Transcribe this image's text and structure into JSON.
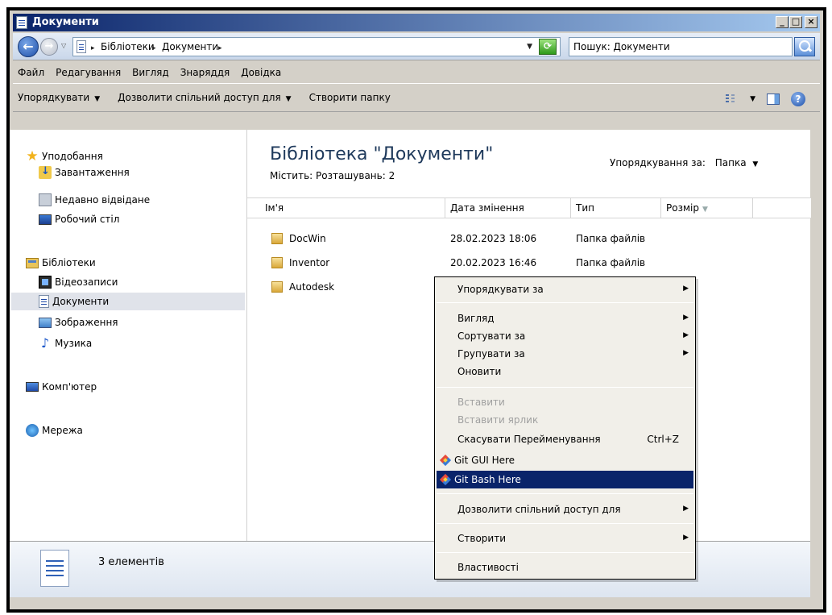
{
  "window": {
    "title": "Документи"
  },
  "address": {
    "crumbs": [
      "Бібліотеки",
      "Документи"
    ],
    "search_placeholder": "Пошук: Документи"
  },
  "menubar": [
    "Файл",
    "Редагування",
    "Вигляд",
    "Знаряддя",
    "Довідка"
  ],
  "commands": {
    "organize": "Упорядкувати",
    "share": "Дозволити спільний доступ для",
    "new_folder": "Створити папку"
  },
  "nav": {
    "favorites": "Уподобання",
    "downloads": "Завантаження",
    "recent": "Недавно відвідане",
    "desktop": "Робочий стіл",
    "libraries": "Бібліотеки",
    "videos": "Відеозаписи",
    "documents": "Документи",
    "pictures": "Зображення",
    "music": "Музика",
    "computer": "Комп'ютер",
    "network": "Мережа"
  },
  "main": {
    "title": "Бібліотека \"Документи\"",
    "subtitle": "Містить: Розташувань: 2",
    "arrange_label": "Упорядкування за:",
    "arrange_value": "Папка",
    "columns": [
      "Ім'я",
      "Дата змінення",
      "Тип",
      "Розмір"
    ],
    "files": [
      {
        "name": "DocWin",
        "date": "28.02.2023 18:06",
        "type": "Папка файлів"
      },
      {
        "name": "Inventor",
        "date": "20.02.2023 16:46",
        "type": "Папка файлів"
      },
      {
        "name": "Autodesk",
        "date": "",
        "type": ""
      }
    ]
  },
  "details": {
    "count": "3 елементів"
  },
  "context_menu": {
    "arrange_by": "Упорядкувати за",
    "view": "Вигляд",
    "sort_by": "Сортувати за",
    "group_by": "Групувати за",
    "refresh": "Оновити",
    "paste": "Вставити",
    "paste_shortcut": "Вставити ярлик",
    "undo_rename": "Скасувати Перейменування",
    "undo_shortcut": "Ctrl+Z",
    "git_gui": "Git GUI Here",
    "git_bash": "Git Bash Here",
    "share_with": "Дозволити спільний доступ для",
    "new": "Створити",
    "properties": "Властивості"
  },
  "colors": {
    "selection": "#0a246a",
    "title_text": "#1e395b"
  }
}
